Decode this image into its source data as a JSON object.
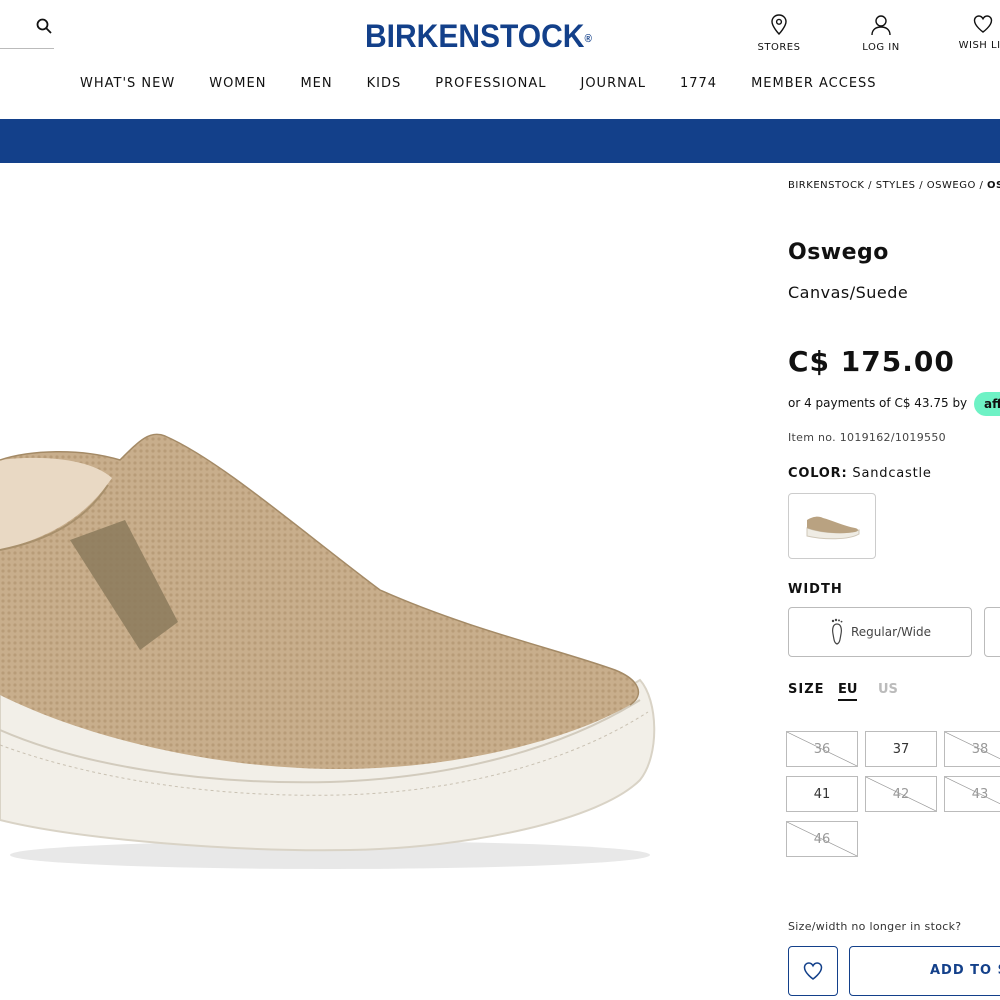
{
  "header": {
    "logo": "BIRKENSTOCK",
    "stores_label": "STORES",
    "login_label": "LOG IN",
    "wishlist_label": "WISH LIS"
  },
  "nav": {
    "items": [
      "WHAT'S NEW",
      "WOMEN",
      "MEN",
      "KIDS",
      "PROFESSIONAL",
      "JOURNAL",
      "1774",
      "MEMBER ACCESS"
    ]
  },
  "breadcrumb": {
    "home": "BIRKENSTOCK",
    "sep": " / ",
    "styles": "STYLES",
    "category": "OSWEGO",
    "current": "OSW"
  },
  "product": {
    "name": "Oswego",
    "material": "Canvas/Suede",
    "price": "C$ 175.00",
    "payments": "or 4 payments of C$ 43.75 by",
    "affirm": "aff",
    "item_no": "Item no. 1019162/1019550",
    "color_label": "COLOR:",
    "color_value": "Sandcastle",
    "width_label": "WIDTH",
    "width_option": "Regular/Wide",
    "size_label": "SIZE",
    "size_eu": "EU",
    "size_us": "US",
    "sizes": [
      {
        "label": "36",
        "available": false
      },
      {
        "label": "37",
        "available": true
      },
      {
        "label": "38",
        "available": false
      },
      {
        "label": "41",
        "available": true
      },
      {
        "label": "42",
        "available": false
      },
      {
        "label": "43",
        "available": false
      },
      {
        "label": "46",
        "available": false
      }
    ],
    "out_of_stock_text": "Size/width no longer in stock?",
    "add_button": "ADD TO S"
  },
  "colors": {
    "brand": "#13408a",
    "affirm": "#6ef2c5",
    "shoe": "#c9b08e"
  }
}
